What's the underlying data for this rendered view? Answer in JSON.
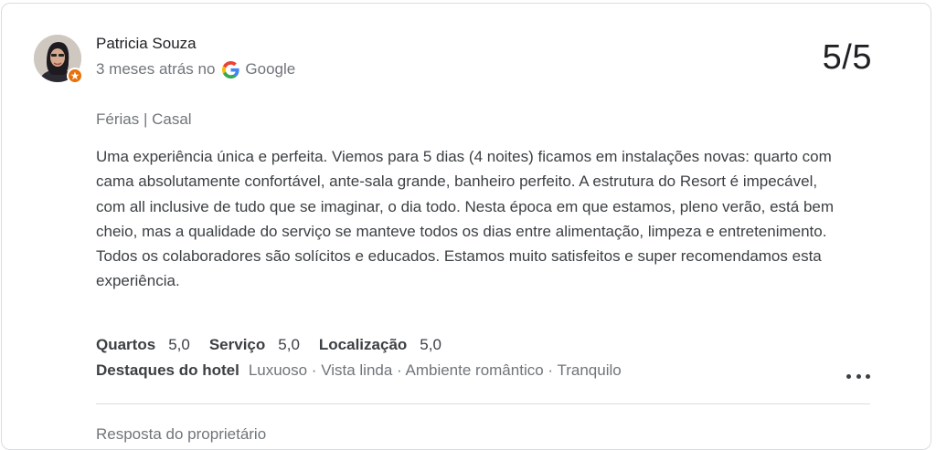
{
  "reviewer": {
    "name": "Patricia Souza",
    "time_ago": "3 meses atrás no",
    "source": "Google"
  },
  "score": "5/5",
  "trip_type": "Férias | Casal",
  "review_text": "Uma experiência única e perfeita. Viemos para 5 dias (4 noites) ficamos em instalações novas: quarto com cama absolutamente confortável, ante-sala grande, banheiro perfeito. A estrutura do Resort é impecável, com all inclusive de tudo que se imaginar, o dia todo. Nesta época em que estamos, pleno verão, está bem cheio, mas a qualidade do serviço se manteve todos os dias entre alimentação, limpeza e entretenimento. Todos os colaboradores são solícitos e educados. Estamos muito satisfeitos e super recomendamos esta experiência.",
  "ratings": [
    {
      "label": "Quartos",
      "value": "5,0"
    },
    {
      "label": "Serviço",
      "value": "5,0"
    },
    {
      "label": "Localização",
      "value": "5,0"
    }
  ],
  "highlights": {
    "label": "Destaques do hotel",
    "items": "Luxuoso · Vista linda · Ambiente romântico · Tranquilo"
  },
  "owner_response_label": "Resposta do proprietário",
  "colors": {
    "local_guide_badge": "#e8710a",
    "divider": "#dadce0",
    "secondary_text": "#70757a"
  },
  "icons": [
    "avatar",
    "local-guide-badge-icon",
    "google-g-icon",
    "more-options-icon"
  ]
}
